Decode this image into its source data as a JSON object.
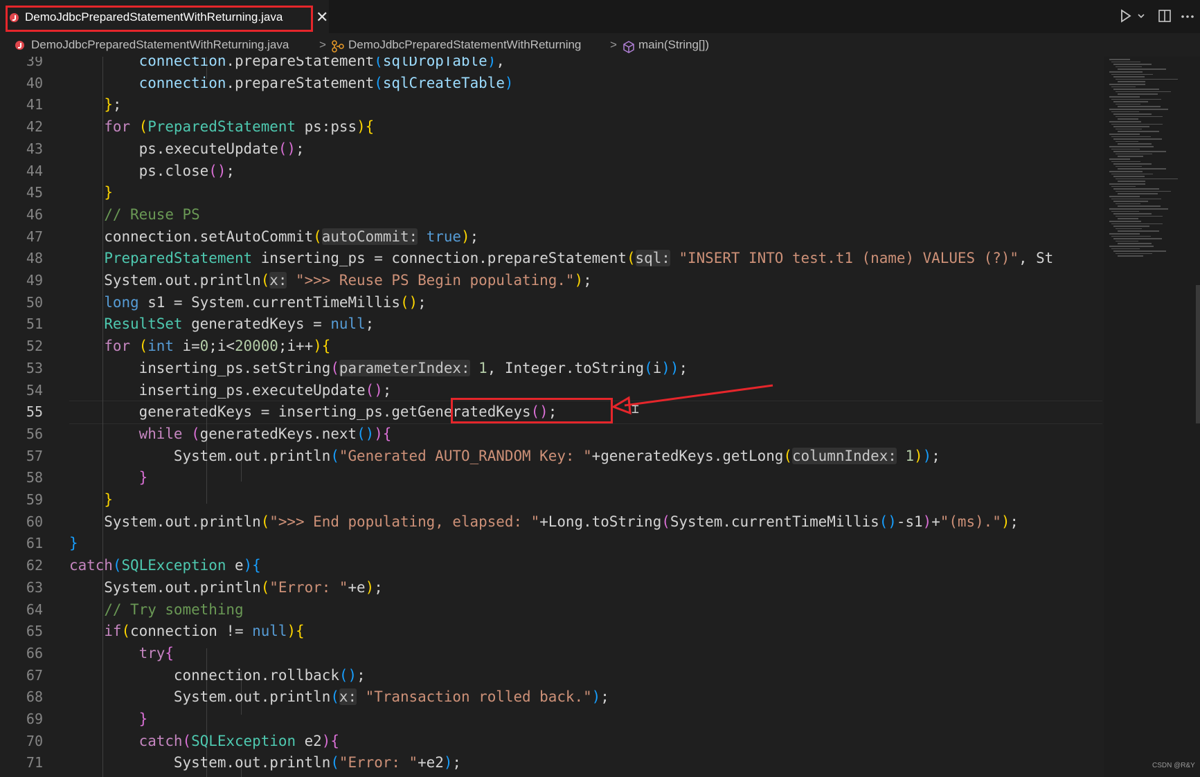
{
  "tab": {
    "label": "DemoJdbcPreparedStatementWithReturning.java",
    "close": "✕"
  },
  "toolbar": {
    "run_icon": "run-icon",
    "dropdown_icon": "chevron-down-icon",
    "split_icon": "split-editor-icon",
    "more_icon": "more-actions-icon"
  },
  "breadcrumb": {
    "file": "DemoJdbcPreparedStatementWithReturning.java",
    "class": "DemoJdbcPreparedStatementWithReturning",
    "method": "main(String[])",
    "separator": ">"
  },
  "colors": {
    "keyword": "#569cd6",
    "type": "#4ec9b0",
    "string": "#ce9178",
    "number": "#b5cea8",
    "comment": "#6a9955",
    "annotation": "#e5262b"
  },
  "editor": {
    "current_line": "55",
    "lines": [
      {
        "n": "39",
        "tokens": [
          [
            "",
            "        "
          ],
          [
            "va",
            "connection"
          ],
          [
            "",
            ".prepareStatement"
          ],
          [
            "p3",
            "("
          ],
          [
            "va",
            "sqlDropTable"
          ],
          [
            "p3",
            ")"
          ],
          [
            "",
            ","
          ]
        ]
      },
      {
        "n": "40",
        "tokens": [
          [
            "",
            "        "
          ],
          [
            "va",
            "connection"
          ],
          [
            "",
            ".prepareStatement"
          ],
          [
            "p3",
            "("
          ],
          [
            "va",
            "sqlCreateTable"
          ],
          [
            "p3",
            ")"
          ]
        ]
      },
      {
        "n": "41",
        "tokens": [
          [
            "",
            "    "
          ],
          [
            "p1",
            "}"
          ],
          [
            "",
            ";"
          ]
        ]
      },
      {
        "n": "42",
        "tokens": [
          [
            "",
            "    "
          ],
          [
            "kwc",
            "for"
          ],
          [
            "",
            "",
            " "
          ],
          [
            "p1",
            "("
          ],
          [
            "ty",
            "PreparedStatement"
          ],
          [
            "",
            " ps:pss"
          ],
          [
            "p1",
            ")"
          ],
          [
            "p1",
            "{"
          ]
        ]
      },
      {
        "n": "43",
        "tokens": [
          [
            "",
            "        ps.executeUpdate"
          ],
          [
            "p2",
            "()"
          ],
          [
            "",
            ";"
          ]
        ]
      },
      {
        "n": "44",
        "tokens": [
          [
            "",
            "        ps.close"
          ],
          [
            "p2",
            "()"
          ],
          [
            "",
            ";"
          ]
        ]
      },
      {
        "n": "45",
        "tokens": [
          [
            "",
            "    "
          ],
          [
            "p1",
            "}"
          ]
        ]
      },
      {
        "n": "46",
        "tokens": [
          [
            "",
            "    "
          ],
          [
            "cm",
            "// Reuse PS"
          ]
        ]
      },
      {
        "n": "47",
        "tokens": [
          [
            "",
            "    connection.setAutoCommit"
          ],
          [
            "p1",
            "("
          ],
          [
            "hint",
            "autoCommit:"
          ],
          [
            "",
            " "
          ],
          [
            "kw",
            "true"
          ],
          [
            "p1",
            ")"
          ],
          [
            "",
            ";"
          ]
        ]
      },
      {
        "n": "48",
        "tokens": [
          [
            "",
            "    "
          ],
          [
            "ty",
            "PreparedStatement"
          ],
          [
            "",
            " inserting_ps = connection.prepareStatement"
          ],
          [
            "p1",
            "("
          ],
          [
            "hint",
            "sql:"
          ],
          [
            "",
            " "
          ],
          [
            "st",
            "\"INSERT INTO test.t1 (name) VALUES (?)\""
          ],
          [
            "",
            ", St"
          ]
        ]
      },
      {
        "n": "49",
        "tokens": [
          [
            "",
            "    System.out.println"
          ],
          [
            "p1",
            "("
          ],
          [
            "hint",
            "x:"
          ],
          [
            "",
            " "
          ],
          [
            "st",
            "\">>> Reuse PS Begin populating.\""
          ],
          [
            "p1",
            ")"
          ],
          [
            "",
            ";"
          ]
        ]
      },
      {
        "n": "50",
        "tokens": [
          [
            "",
            "    "
          ],
          [
            "kw",
            "long"
          ],
          [
            "",
            " s1 = System.currentTimeMillis"
          ],
          [
            "p1",
            "()"
          ],
          [
            "",
            ";"
          ]
        ]
      },
      {
        "n": "51",
        "tokens": [
          [
            "",
            "    "
          ],
          [
            "ty",
            "ResultSet"
          ],
          [
            "",
            " generatedKeys = "
          ],
          [
            "kw",
            "null"
          ],
          [
            "",
            ";"
          ]
        ]
      },
      {
        "n": "52",
        "tokens": [
          [
            "",
            "    "
          ],
          [
            "kwc",
            "for"
          ],
          [
            "",
            " "
          ],
          [
            "p1",
            "("
          ],
          [
            "kw",
            "int"
          ],
          [
            "",
            " i="
          ],
          [
            "nu",
            "0"
          ],
          [
            "",
            ";i<"
          ],
          [
            "nu",
            "20000"
          ],
          [
            "",
            ";i++"
          ],
          [
            "p1",
            "){"
          ]
        ]
      },
      {
        "n": "53",
        "tokens": [
          [
            "",
            "        inserting_ps.setString"
          ],
          [
            "p2",
            "("
          ],
          [
            "hint",
            "parameterIndex:"
          ],
          [
            "",
            " "
          ],
          [
            "nu",
            "1"
          ],
          [
            "",
            ", Integer.toString"
          ],
          [
            "p3",
            "("
          ],
          [
            "",
            "i"
          ],
          [
            "p3",
            "))"
          ],
          [
            "",
            ";"
          ]
        ]
      },
      {
        "n": "54",
        "tokens": [
          [
            "",
            "        inserting_ps.executeUpdate"
          ],
          [
            "p2",
            "()"
          ],
          [
            "",
            ";"
          ]
        ]
      },
      {
        "n": "55",
        "tokens": [
          [
            "",
            "        generatedKeys = inserting_ps."
          ],
          [
            "",
            "getGeneratedKeys"
          ],
          [
            "p2",
            "()"
          ],
          [
            "",
            ";"
          ]
        ]
      },
      {
        "n": "56",
        "tokens": [
          [
            "",
            "        "
          ],
          [
            "kwc",
            "while"
          ],
          [
            "",
            " "
          ],
          [
            "p2",
            "("
          ],
          [
            "",
            "generatedKeys.next"
          ],
          [
            "p3",
            "()"
          ],
          [
            "p2",
            ")"
          ],
          [
            "p2",
            "{"
          ]
        ]
      },
      {
        "n": "57",
        "tokens": [
          [
            "",
            "            System.out.println"
          ],
          [
            "p3",
            "("
          ],
          [
            "st",
            "\"Generated AUTO_RANDOM Key: \""
          ],
          [
            "",
            "+generatedKeys.getLong"
          ],
          [
            "p1",
            "("
          ],
          [
            "hint",
            "columnIndex:"
          ],
          [
            "",
            " "
          ],
          [
            "nu",
            "1"
          ],
          [
            "p1",
            ")"
          ],
          [
            "p3",
            ")"
          ],
          [
            "",
            ";"
          ]
        ]
      },
      {
        "n": "58",
        "tokens": [
          [
            "",
            "        "
          ],
          [
            "p2",
            "}"
          ]
        ]
      },
      {
        "n": "59",
        "tokens": [
          [
            "",
            "    "
          ],
          [
            "p1",
            "}"
          ]
        ]
      },
      {
        "n": "60",
        "tokens": [
          [
            "",
            "    System.out.println"
          ],
          [
            "p1",
            "("
          ],
          [
            "st",
            "\">>> End populating, elapsed: \""
          ],
          [
            "",
            "+Long.toString"
          ],
          [
            "p2",
            "("
          ],
          [
            "",
            "System.currentTimeMillis"
          ],
          [
            "p3",
            "()"
          ],
          [
            "",
            "-s1"
          ],
          [
            "p2",
            ")"
          ],
          [
            "",
            "+"
          ],
          [
            "st",
            "\"(ms).\""
          ],
          [
            "p1",
            ")"
          ],
          [
            "",
            ";"
          ]
        ]
      },
      {
        "n": "61",
        "tokens": [
          [
            "",
            ""
          ],
          [
            "p3",
            "}"
          ]
        ]
      },
      {
        "n": "62",
        "tokens": [
          [
            "",
            ""
          ],
          [
            "kwc",
            "catch"
          ],
          [
            "p3",
            "("
          ],
          [
            "ty",
            "SQLException"
          ],
          [
            "",
            " e"
          ],
          [
            "p3",
            ")"
          ],
          [
            "p3",
            "{"
          ]
        ]
      },
      {
        "n": "63",
        "tokens": [
          [
            "",
            "    System.out.println"
          ],
          [
            "p1",
            "("
          ],
          [
            "st",
            "\"Error: \""
          ],
          [
            "",
            "+e"
          ],
          [
            "p1",
            ")"
          ],
          [
            "",
            ";"
          ]
        ]
      },
      {
        "n": "64",
        "tokens": [
          [
            "",
            "    "
          ],
          [
            "cm",
            "// Try something"
          ]
        ]
      },
      {
        "n": "65",
        "tokens": [
          [
            "",
            "    "
          ],
          [
            "kwc",
            "if"
          ],
          [
            "p1",
            "("
          ],
          [
            "",
            "connection != "
          ],
          [
            "kw",
            "null"
          ],
          [
            "p1",
            ")"
          ],
          [
            "p1",
            "{"
          ]
        ]
      },
      {
        "n": "66",
        "tokens": [
          [
            "",
            "        "
          ],
          [
            "kwc",
            "try"
          ],
          [
            "p2",
            "{"
          ]
        ]
      },
      {
        "n": "67",
        "tokens": [
          [
            "",
            "            connection.rollback"
          ],
          [
            "p3",
            "()"
          ],
          [
            "",
            ";"
          ]
        ]
      },
      {
        "n": "68",
        "tokens": [
          [
            "",
            "            System.out.println"
          ],
          [
            "p3",
            "("
          ],
          [
            "hint",
            "x:"
          ],
          [
            "",
            " "
          ],
          [
            "st",
            "\"Transaction rolled back.\""
          ],
          [
            "p3",
            ")"
          ],
          [
            "",
            ";"
          ]
        ]
      },
      {
        "n": "69",
        "tokens": [
          [
            "",
            "        "
          ],
          [
            "p2",
            "}"
          ]
        ]
      },
      {
        "n": "70",
        "tokens": [
          [
            "",
            "        "
          ],
          [
            "kwc",
            "catch"
          ],
          [
            "p2",
            "("
          ],
          [
            "ty",
            "SQLException"
          ],
          [
            "",
            " e2"
          ],
          [
            "p2",
            ")"
          ],
          [
            "p2",
            "{"
          ]
        ]
      },
      {
        "n": "71",
        "tokens": [
          [
            "",
            "            System.out.println"
          ],
          [
            "p3",
            "("
          ],
          [
            "st",
            "\"Error: \""
          ],
          [
            "",
            "+e2"
          ],
          [
            "p3",
            ")"
          ],
          [
            "",
            ";"
          ]
        ]
      }
    ]
  },
  "watermark": "CSDN @R&Y"
}
